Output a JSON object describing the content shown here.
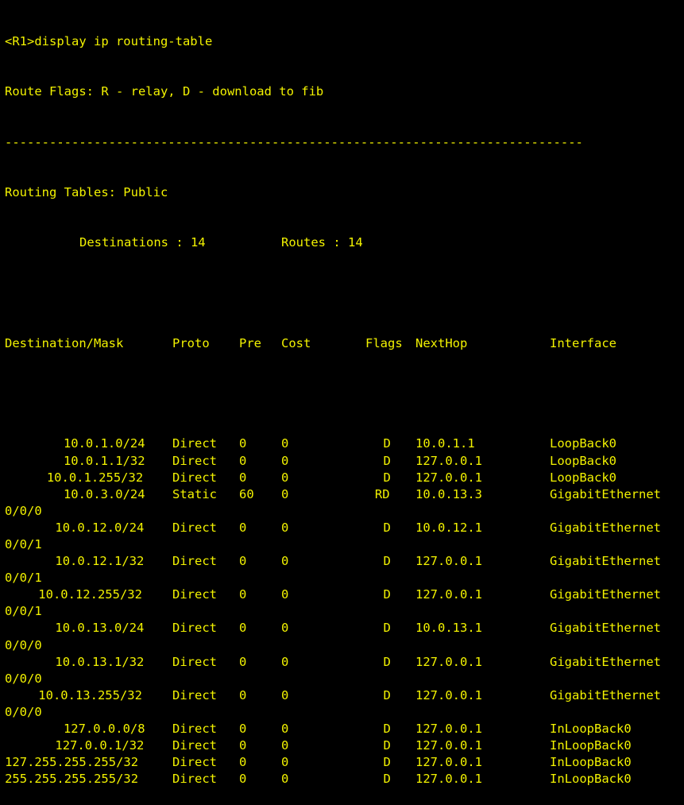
{
  "prompt": "<R1>display ip routing-table",
  "route_flags": "Route Flags: R - relay, D - download to fib",
  "separator": "------------------------------------------------------------------------------",
  "tables_title": "Routing Tables: Public",
  "destinations_label": "Destinations : 14",
  "routes_label": "Routes : 14",
  "headers": {
    "destination": "Destination/Mask",
    "proto": "Proto",
    "pre": "Pre",
    "cost": "Cost",
    "flags": "Flags",
    "nexthop": "NextHop",
    "interface": "Interface"
  },
  "rows": [
    {
      "dest": "10.0.1.0/24",
      "proto": "Direct",
      "pre": "0",
      "cost": "0",
      "flags": "D",
      "nexthop": "10.0.1.1",
      "iface": "LoopBack0",
      "iface_cont": ""
    },
    {
      "dest": "10.0.1.1/32",
      "proto": "Direct",
      "pre": "0",
      "cost": "0",
      "flags": "D",
      "nexthop": "127.0.0.1",
      "iface": "LoopBack0",
      "iface_cont": ""
    },
    {
      "dest": "10.0.1.255/32",
      "proto": "Direct",
      "pre": "0",
      "cost": "0",
      "flags": "D",
      "nexthop": "127.0.0.1",
      "iface": "LoopBack0",
      "iface_cont": ""
    },
    {
      "dest": "10.0.3.0/24",
      "proto": "Static",
      "pre": "60",
      "cost": "0",
      "flags": "RD",
      "nexthop": "10.0.13.3",
      "iface": "GigabitEthernet",
      "iface_cont": "0/0/0"
    },
    {
      "dest": "10.0.12.0/24",
      "proto": "Direct",
      "pre": "0",
      "cost": "0",
      "flags": "D",
      "nexthop": "10.0.12.1",
      "iface": "GigabitEthernet",
      "iface_cont": "0/0/1"
    },
    {
      "dest": "10.0.12.1/32",
      "proto": "Direct",
      "pre": "0",
      "cost": "0",
      "flags": "D",
      "nexthop": "127.0.0.1",
      "iface": "GigabitEthernet",
      "iface_cont": "0/0/1"
    },
    {
      "dest": "10.0.12.255/32",
      "proto": "Direct",
      "pre": "0",
      "cost": "0",
      "flags": "D",
      "nexthop": "127.0.0.1",
      "iface": "GigabitEthernet",
      "iface_cont": "0/0/1"
    },
    {
      "dest": "10.0.13.0/24",
      "proto": "Direct",
      "pre": "0",
      "cost": "0",
      "flags": "D",
      "nexthop": "10.0.13.1",
      "iface": "GigabitEthernet",
      "iface_cont": "0/0/0"
    },
    {
      "dest": "10.0.13.1/32",
      "proto": "Direct",
      "pre": "0",
      "cost": "0",
      "flags": "D",
      "nexthop": "127.0.0.1",
      "iface": "GigabitEthernet",
      "iface_cont": "0/0/0"
    },
    {
      "dest": "10.0.13.255/32",
      "proto": "Direct",
      "pre": "0",
      "cost": "0",
      "flags": "D",
      "nexthop": "127.0.0.1",
      "iface": "GigabitEthernet",
      "iface_cont": "0/0/0"
    },
    {
      "dest": "127.0.0.0/8",
      "proto": "Direct",
      "pre": "0",
      "cost": "0",
      "flags": "D",
      "nexthop": "127.0.0.1",
      "iface": "InLoopBack0",
      "iface_cont": ""
    },
    {
      "dest": "127.0.0.1/32",
      "proto": "Direct",
      "pre": "0",
      "cost": "0",
      "flags": "D",
      "nexthop": "127.0.0.1",
      "iface": "InLoopBack0",
      "iface_cont": ""
    },
    {
      "dest": "127.255.255.255/32",
      "proto": "Direct",
      "pre": "0",
      "cost": "0",
      "flags": "D",
      "nexthop": "127.0.0.1",
      "iface": "InLoopBack0",
      "iface_cont": ""
    },
    {
      "dest": "255.255.255.255/32",
      "proto": "Direct",
      "pre": "0",
      "cost": "0",
      "flags": "D",
      "nexthop": "127.0.0.1",
      "iface": "InLoopBack0",
      "iface_cont": ""
    }
  ],
  "colors": {
    "background": "#000000",
    "text": "#f2f200"
  }
}
